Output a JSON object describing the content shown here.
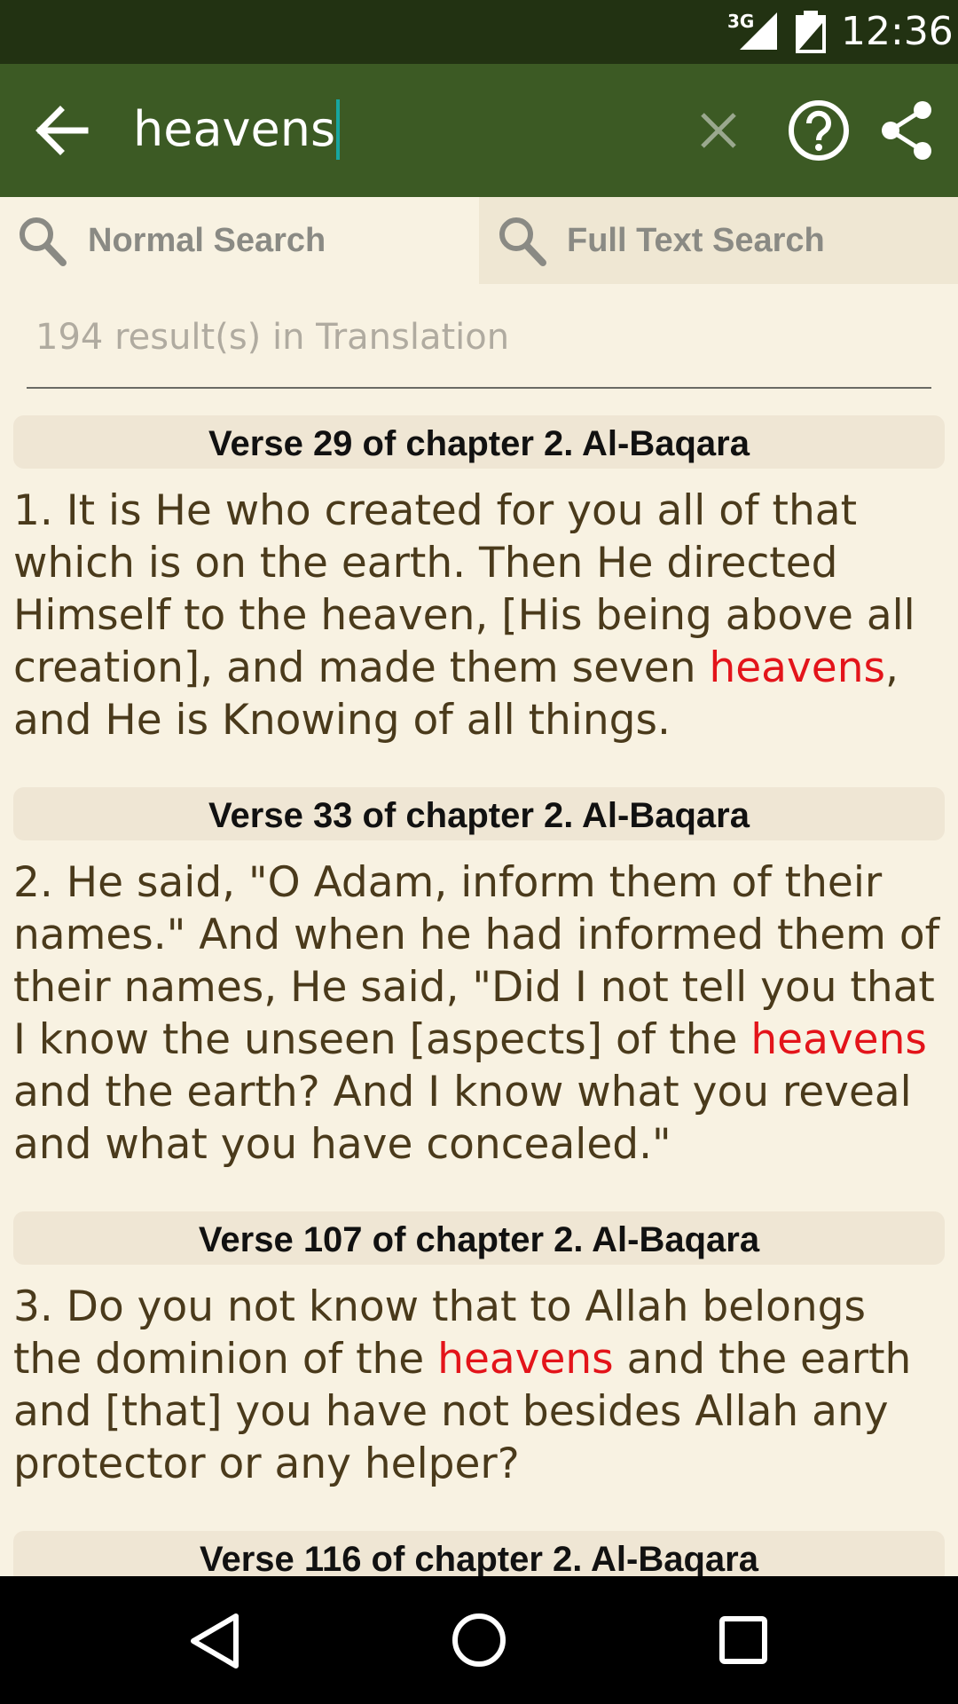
{
  "status_bar": {
    "network": "3G",
    "time": "12:36"
  },
  "app_bar": {
    "back_icon": "arrow-left-icon",
    "query": "heavens",
    "clear_icon": "close-icon",
    "help_icon": "help-circle-icon",
    "share_icon": "share-icon"
  },
  "tabs": [
    {
      "label": "Normal Search",
      "icon": "search-icon",
      "selected": true
    },
    {
      "label": "Full Text Search",
      "icon": "search-icon",
      "selected": false
    }
  ],
  "result_count": "194 result(s) in Translation",
  "results": [
    {
      "header": "Verse 29 of chapter 2. Al-Baqara",
      "before": "1. It is He who created for you all of that which is on the earth. Then He directed Himself to the heaven, [His being above all creation], and made them seven ",
      "match": "heavens",
      "after": ", and He is Knowing of all things."
    },
    {
      "header": "Verse 33 of chapter 2. Al-Baqara",
      "before": "2. He said, \"O Adam, inform them of their names.\" And when he had informed them of their names, He said, \"Did I not tell you that I know the unseen [aspects] of the ",
      "match": "heavens",
      "after": " and the earth? And I know what you reveal and what you have concealed.\""
    },
    {
      "header": "Verse 107 of chapter 2. Al-Baqara",
      "before": "3. Do you not know that to Allah belongs the dominion of the ",
      "match": "heavens",
      "after": " and the earth and [that] you have not besides Allah any protector or any helper?"
    },
    {
      "header": "Verse 116 of chapter 2. Al-Baqara"
    }
  ],
  "nav_bar": {
    "back_icon": "triangle-back-icon",
    "home_icon": "circle-home-icon",
    "recents_icon": "square-recents-icon"
  },
  "colors": {
    "status_bar": "#223212",
    "app_bar": "#3c5a24",
    "background": "#f8f2e2",
    "highlight": "#e3141a",
    "verse_text": "#4a3a1b"
  }
}
